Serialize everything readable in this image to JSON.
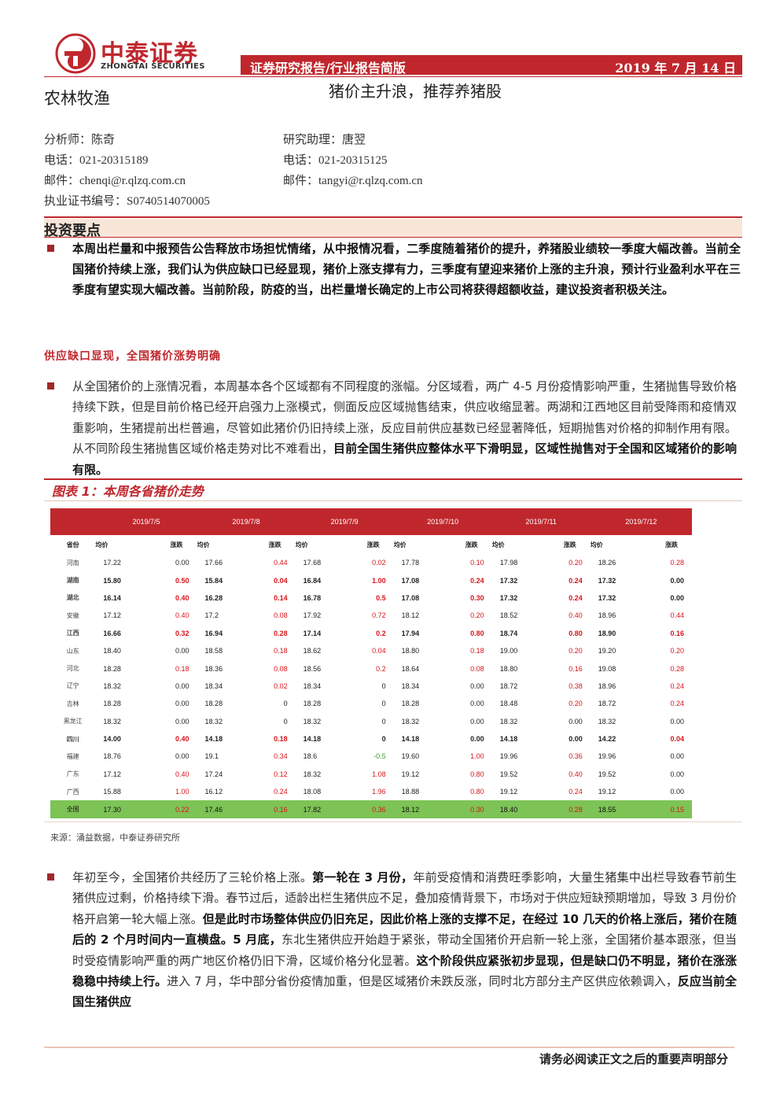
{
  "header": {
    "brand_cn": "中泰证券",
    "brand_en": "ZHONGTAI SECURITIES",
    "report_type": "证券研究报告/行业报告简版",
    "date": "2019 年 7 月 14 日",
    "sector": "农林牧渔",
    "title": "猪价主升浪，推荐养猪股"
  },
  "analyst": {
    "name": "分析师：陈奇",
    "phone": "电话：021-20315189",
    "email": "邮件：chenqi@r.qlzq.com.cn",
    "license": "执业证书编号：S0740514070005"
  },
  "assistant": {
    "name": "研究助理：唐翌",
    "phone": "电话：021-20315125",
    "email": "邮件：tangyi@r.qlzq.com.cn"
  },
  "section_title": "投资要点",
  "summary": "本周出栏量和中报预告公告释放市场担忧情绪，从中报情况看，二季度随着猪价的提升，养猪股业绩较一季度大幅改善。当前全国猪价持续上涨，我们认为供应缺口已经显现，猪价上涨支撑有力，三季度有望迎来猪价上涨的主升浪，预计行业盈利水平在三季度有望实现大幅改善。当前阶段，防疫的当，出栏量增长确定的上市公司将获得超额收益，建议投资者积极关注。",
  "subheading": "供应缺口显现，全国猪价涨势明确",
  "para1": {
    "normal": "从全国猪价的上涨情况看，本周基本各个区域都有不同程度的涨幅。分区域看，两广 4-5 月份疫情影响严重，生猪抛售导致价格持续下跌，但是目前价格已经开启强力上涨模式，侧面反应区域抛售结束，供应收缩显著。两湖和江西地区目前受降雨和疫情双重影响，生猪提前出栏普遍，尽管如此猪价仍旧持续上涨，反应目前供应基数已经显著降低，短期抛售对价格的抑制作用有限。从不同阶段生猪抛售区域价格走势对比不难看出，",
    "bold": "目前全国生猪供应整体水平下滑明显，区域性抛售对于全国和区域猪价的影响有限。"
  },
  "figure": {
    "title": "图表 1：本周各省猪价走势",
    "source": "来源：涌益数据，中泰证券研究所",
    "dates": [
      "2019/7/5",
      "2019/7/8",
      "2019/7/9",
      "2019/7/10",
      "2019/7/11",
      "2019/7/12"
    ],
    "col_province": "省份",
    "col_price": "均价",
    "col_change": "涨跌",
    "rows": [
      {
        "province": "河南",
        "bold": false,
        "cells": [
          [
            "17.22",
            "0.00"
          ],
          [
            "17.66",
            "0.44"
          ],
          [
            "17.68",
            "0.02"
          ],
          [
            "17.78",
            "0.10"
          ],
          [
            "17.98",
            "0.20"
          ],
          [
            "18.26",
            "0.28"
          ]
        ]
      },
      {
        "province": "湖南",
        "bold": true,
        "cells": [
          [
            "15.80",
            "0.50"
          ],
          [
            "15.84",
            "0.04"
          ],
          [
            "16.84",
            "1.00"
          ],
          [
            "17.08",
            "0.24"
          ],
          [
            "17.32",
            "0.24"
          ],
          [
            "17.32",
            "0.00"
          ]
        ]
      },
      {
        "province": "湖北",
        "bold": true,
        "cells": [
          [
            "16.14",
            "0.40"
          ],
          [
            "16.28",
            "0.14"
          ],
          [
            "16.78",
            "0.5"
          ],
          [
            "17.08",
            "0.30"
          ],
          [
            "17.32",
            "0.24"
          ],
          [
            "17.32",
            "0.00"
          ]
        ]
      },
      {
        "province": "安徽",
        "bold": false,
        "cells": [
          [
            "17.12",
            "0.40"
          ],
          [
            "17.2",
            "0.08"
          ],
          [
            "17.92",
            "0.72"
          ],
          [
            "18.12",
            "0.20"
          ],
          [
            "18.52",
            "0.40"
          ],
          [
            "18.96",
            "0.44"
          ]
        ]
      },
      {
        "province": "江西",
        "bold": true,
        "cells": [
          [
            "16.66",
            "0.32"
          ],
          [
            "16.94",
            "0.28"
          ],
          [
            "17.14",
            "0.2"
          ],
          [
            "17.94",
            "0.80"
          ],
          [
            "18.74",
            "0.80"
          ],
          [
            "18.90",
            "0.16"
          ]
        ]
      },
      {
        "province": "山东",
        "bold": false,
        "cells": [
          [
            "18.40",
            "0.00"
          ],
          [
            "18.58",
            "0.18"
          ],
          [
            "18.62",
            "0.04"
          ],
          [
            "18.80",
            "0.18"
          ],
          [
            "19.00",
            "0.20"
          ],
          [
            "19.20",
            "0.20"
          ]
        ]
      },
      {
        "province": "河北",
        "bold": false,
        "cells": [
          [
            "18.28",
            "0.18"
          ],
          [
            "18.36",
            "0.08"
          ],
          [
            "18.56",
            "0.2"
          ],
          [
            "18.64",
            "0.08"
          ],
          [
            "18.80",
            "0.16"
          ],
          [
            "19.08",
            "0.28"
          ]
        ]
      },
      {
        "province": "辽宁",
        "bold": false,
        "cells": [
          [
            "18.32",
            "0.00"
          ],
          [
            "18.34",
            "0.02"
          ],
          [
            "18.34",
            "0"
          ],
          [
            "18.34",
            "0.00"
          ],
          [
            "18.72",
            "0.38"
          ],
          [
            "18.96",
            "0.24"
          ]
        ]
      },
      {
        "province": "吉林",
        "bold": false,
        "cells": [
          [
            "18.28",
            "0.00"
          ],
          [
            "18.28",
            "0"
          ],
          [
            "18.28",
            "0"
          ],
          [
            "18.28",
            "0.00"
          ],
          [
            "18.48",
            "0.20"
          ],
          [
            "18.72",
            "0.24"
          ]
        ]
      },
      {
        "province": "黑龙江",
        "bold": false,
        "cells": [
          [
            "18.32",
            "0.00"
          ],
          [
            "18.32",
            "0"
          ],
          [
            "18.32",
            "0"
          ],
          [
            "18.32",
            "0.00"
          ],
          [
            "18.32",
            "0.00"
          ],
          [
            "18.32",
            "0.00"
          ]
        ]
      },
      {
        "province": "四川",
        "bold": true,
        "cells": [
          [
            "14.00",
            "0.40"
          ],
          [
            "14.18",
            "0.18"
          ],
          [
            "14.18",
            "0"
          ],
          [
            "14.18",
            "0.00"
          ],
          [
            "14.18",
            "0.00"
          ],
          [
            "14.22",
            "0.04"
          ]
        ]
      },
      {
        "province": "福建",
        "bold": false,
        "cells": [
          [
            "18.76",
            "0.00"
          ],
          [
            "19.1",
            "0.34"
          ],
          [
            "18.6",
            "-0.5"
          ],
          [
            "19.60",
            "1.00"
          ],
          [
            "19.96",
            "0.36"
          ],
          [
            "19.96",
            "0.00"
          ]
        ]
      },
      {
        "province": "广东",
        "bold": false,
        "cells": [
          [
            "17.12",
            "0.40"
          ],
          [
            "17.24",
            "0.12"
          ],
          [
            "18.32",
            "1.08"
          ],
          [
            "19.12",
            "0.80"
          ],
          [
            "19.52",
            "0.40"
          ],
          [
            "19.52",
            "0.00"
          ]
        ]
      },
      {
        "province": "广西",
        "bold": false,
        "cells": [
          [
            "15.88",
            "1.00"
          ],
          [
            "16.12",
            "0.24"
          ],
          [
            "18.08",
            "1.96"
          ],
          [
            "18.88",
            "0.80"
          ],
          [
            "19.12",
            "0.24"
          ],
          [
            "19.12",
            "0.00"
          ]
        ]
      }
    ],
    "total": {
      "province": "全国",
      "cells": [
        [
          "17.30",
          "0.22"
        ],
        [
          "17.46",
          "0.16"
        ],
        [
          "17.82",
          "0.36"
        ],
        [
          "18.12",
          "0.30"
        ],
        [
          "18.40",
          "0.28"
        ],
        [
          "18.55",
          "0.15"
        ]
      ]
    }
  },
  "para2": [
    {
      "t": "年初至今，全国猪价共经历了三轮价格上涨。",
      "b": false
    },
    {
      "t": "第一轮在 3 月份，",
      "b": true
    },
    {
      "t": "年前受疫情和消费旺季影响，大量生猪集中出栏导致春节前生猪供应过剩，价格持续下滑。春节过后，适龄出栏生猪供应不足，叠加疫情背景下，市场对于供应短缺预期增加，导致 3 月份价格开启第一轮大幅上涨。",
      "b": false
    },
    {
      "t": "但是此时市场整体供应仍旧充足，因此价格上涨的支撑不足，在经过 10 几天的价格上涨后，猪价在随后的 2 个月时间内一直横盘。5 月底，",
      "b": true
    },
    {
      "t": "东北生猪供应开始趋于紧张，带动全国猪价开启新一轮上涨，全国猪价基本跟涨，但当时受疫情影响严重的两广地区价格仍旧下滑，区域价格分化显著。",
      "b": false
    },
    {
      "t": "这个阶段供应紧张初步显现，但是缺口仍不明显，猪价在涨涨稳稳中持续上行。",
      "b": true
    },
    {
      "t": "进入 7 月，华中部分省份疫情加重，但是区域猪价未跌反涨，同时北方部分主产区供应依赖调入，",
      "b": false
    },
    {
      "t": "反应当前全国生猪供应",
      "b": true
    }
  ],
  "footer": "请务必阅读正文之后的重要声明部分",
  "colors": {
    "brand_red": "#c0272d",
    "up": "#d8141b",
    "down": "#2a9d2a",
    "total_bg": "#7dc355"
  }
}
